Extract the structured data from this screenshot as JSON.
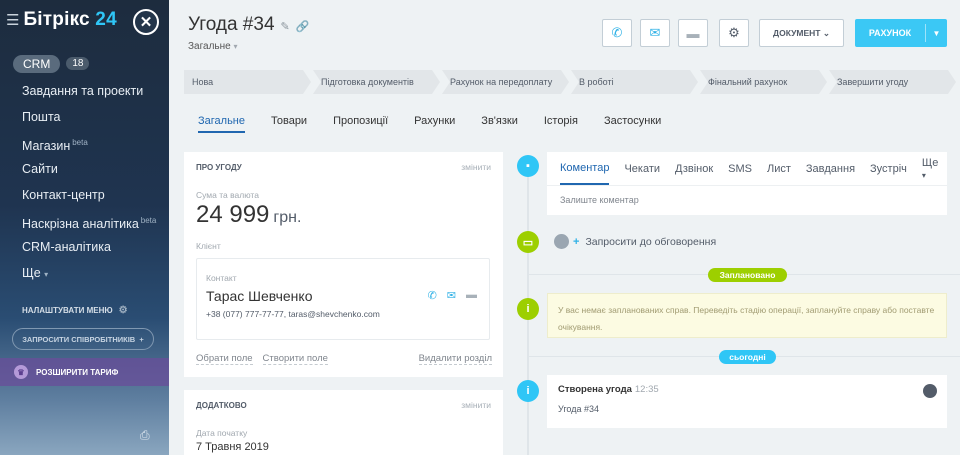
{
  "sidebar": {
    "logo_text": "Бітрікс",
    "logo_num": "24",
    "crm_label": "CRM",
    "crm_count": "18",
    "items": [
      {
        "label": "Завдання та проекти",
        "sup": ""
      },
      {
        "label": "Пошта",
        "sup": ""
      },
      {
        "label": "Магазин",
        "sup": "beta"
      },
      {
        "label": "Сайти",
        "sup": ""
      },
      {
        "label": "Контакт-центр",
        "sup": ""
      },
      {
        "label": "Наскрізна аналітика",
        "sup": "beta"
      },
      {
        "label": "CRM-аналітика",
        "sup": ""
      },
      {
        "label": "Ще",
        "sup": ""
      }
    ],
    "configure_menu": "НАЛАШТУВАТИ МЕНЮ",
    "invite_staff": "ЗАПРОСИТИ СПІВРОБІТНИКІВ",
    "upgrade": "РОЗШИРИТИ ТАРИФ"
  },
  "header": {
    "title": "Угода #34",
    "subtitle": "Загальне",
    "document_btn": "ДОКУМЕНТ",
    "invoice_btn": "РАХУНОК"
  },
  "stages": [
    "Нова",
    "Підготовка документів",
    "Рахунок на передоплату",
    "В роботі",
    "Фінальний рахунок",
    "Завершити угоду"
  ],
  "tabs": [
    "Загальне",
    "Товари",
    "Пропозиції",
    "Рахунки",
    "Зв'язки",
    "Історія",
    "Застосунки"
  ],
  "about_card": {
    "heading": "ПРО УГОДУ",
    "edit": "змінити",
    "amount_label": "Сума та валюта",
    "amount": "24 999",
    "currency": "грн.",
    "client_label": "Клієнт",
    "contact_label": "Контакт",
    "contact_name": "Тарас Шевченко",
    "contact_info": "+38 (077) 777-77-77, taras@shevchenko.com",
    "select_field": "Обрати поле",
    "create_field": "Створити поле",
    "delete_section": "Видалити розділ"
  },
  "extra_card": {
    "heading": "ДОДАТКОВО",
    "edit": "змінити",
    "start_label": "Дата початку",
    "start_value": "7 Травня 2019"
  },
  "activity": {
    "tabs": [
      "Коментар",
      "Чекати",
      "Дзвінок",
      "SMS",
      "Лист",
      "Завдання",
      "Зустріч"
    ],
    "more": "Ще",
    "placeholder": "Залиште коментар",
    "invite": "Запросити до обговорення",
    "planned_badge": "Заплановано",
    "warning": "У вас немає запланованих справ. Переведіть стадію операції, заплануйте справу або поставте очікування.",
    "today_badge": "сьогодні",
    "event_title": "Створена угода",
    "event_time": "12:35",
    "event_sub": "Угода #34"
  },
  "colors": {
    "accent": "#3bc8f5",
    "link": "#2067b0",
    "planned": "#9dcf00",
    "today": "#2fc6f6"
  }
}
